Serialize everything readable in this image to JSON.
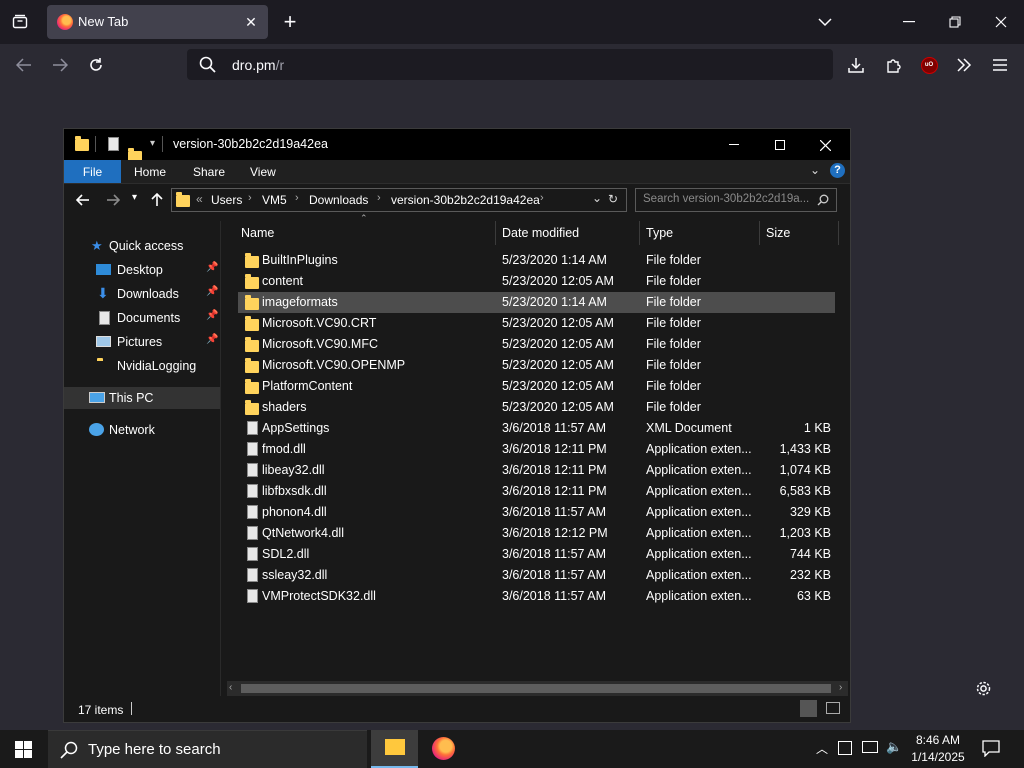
{
  "browser": {
    "tab_title": "New Tab",
    "new_tab": "+",
    "url_host": "dro.pm",
    "url_path": "/r",
    "icons": {
      "tab_list": "collections-icon",
      "back": "back-arrow-icon",
      "forward": "forward-arrow-icon",
      "reload": "reload-icon",
      "search": "search-icon",
      "downloads": "download-icon",
      "extensions": "puzzle-icon",
      "ublock": "ublock-icon",
      "overflow": "chevron-double-right-icon",
      "menu": "hamburger-menu-icon"
    }
  },
  "explorer": {
    "title": "version-30b2b2c2d19a42ea",
    "ribbon": [
      "File",
      "Home",
      "Share",
      "View"
    ],
    "breadcrumb": [
      "«",
      "Users",
      "VM5",
      "Downloads",
      "version-30b2b2c2d19a42ea"
    ],
    "search_placeholder": "Search version-30b2b2c2d19a...",
    "nav": {
      "quick_access": "Quick access",
      "desktop": "Desktop",
      "downloads": "Downloads",
      "documents": "Documents",
      "pictures": "Pictures",
      "nvidia": "NvidiaLogging",
      "this_pc": "This PC",
      "network": "Network"
    },
    "columns": {
      "name": "Name",
      "date": "Date modified",
      "type": "Type",
      "size": "Size"
    },
    "files": [
      {
        "name": "BuiltInPlugins",
        "date": "5/23/2020 1:14 AM",
        "type": "File folder",
        "size": "",
        "kind": "folder"
      },
      {
        "name": "content",
        "date": "5/23/2020 12:05 AM",
        "type": "File folder",
        "size": "",
        "kind": "folder"
      },
      {
        "name": "imageformats",
        "date": "5/23/2020 1:14 AM",
        "type": "File folder",
        "size": "",
        "kind": "folder"
      },
      {
        "name": "Microsoft.VC90.CRT",
        "date": "5/23/2020 12:05 AM",
        "type": "File folder",
        "size": "",
        "kind": "folder"
      },
      {
        "name": "Microsoft.VC90.MFC",
        "date": "5/23/2020 12:05 AM",
        "type": "File folder",
        "size": "",
        "kind": "folder"
      },
      {
        "name": "Microsoft.VC90.OPENMP",
        "date": "5/23/2020 12:05 AM",
        "type": "File folder",
        "size": "",
        "kind": "folder"
      },
      {
        "name": "PlatformContent",
        "date": "5/23/2020 12:05 AM",
        "type": "File folder",
        "size": "",
        "kind": "folder"
      },
      {
        "name": "shaders",
        "date": "5/23/2020 12:05 AM",
        "type": "File folder",
        "size": "",
        "kind": "folder"
      },
      {
        "name": "AppSettings",
        "date": "3/6/2018 11:57 AM",
        "type": "XML Document",
        "size": "1 KB",
        "kind": "file"
      },
      {
        "name": "fmod.dll",
        "date": "3/6/2018 12:11 PM",
        "type": "Application exten...",
        "size": "1,433 KB",
        "kind": "file"
      },
      {
        "name": "libeay32.dll",
        "date": "3/6/2018 12:11 PM",
        "type": "Application exten...",
        "size": "1,074 KB",
        "kind": "file"
      },
      {
        "name": "libfbxsdk.dll",
        "date": "3/6/2018 12:11 PM",
        "type": "Application exten...",
        "size": "6,583 KB",
        "kind": "file"
      },
      {
        "name": "phonon4.dll",
        "date": "3/6/2018 11:57 AM",
        "type": "Application exten...",
        "size": "329 KB",
        "kind": "file"
      },
      {
        "name": "QtNetwork4.dll",
        "date": "3/6/2018 12:12 PM",
        "type": "Application exten...",
        "size": "1,203 KB",
        "kind": "file"
      },
      {
        "name": "SDL2.dll",
        "date": "3/6/2018 11:57 AM",
        "type": "Application exten...",
        "size": "744 KB",
        "kind": "file"
      },
      {
        "name": "ssleay32.dll",
        "date": "3/6/2018 11:57 AM",
        "type": "Application exten...",
        "size": "232 KB",
        "kind": "file"
      },
      {
        "name": "VMProtectSDK32.dll",
        "date": "3/6/2018 11:57 AM",
        "type": "Application exten...",
        "size": "63 KB",
        "kind": "file"
      }
    ],
    "selected_index": 2,
    "status": "17 items"
  },
  "taskbar": {
    "search_placeholder": "Type here to search",
    "time": "8:46 AM",
    "date": "1/14/2025"
  },
  "colors": {
    "accent": "#1f6fbf",
    "folder": "#ffd35c"
  }
}
